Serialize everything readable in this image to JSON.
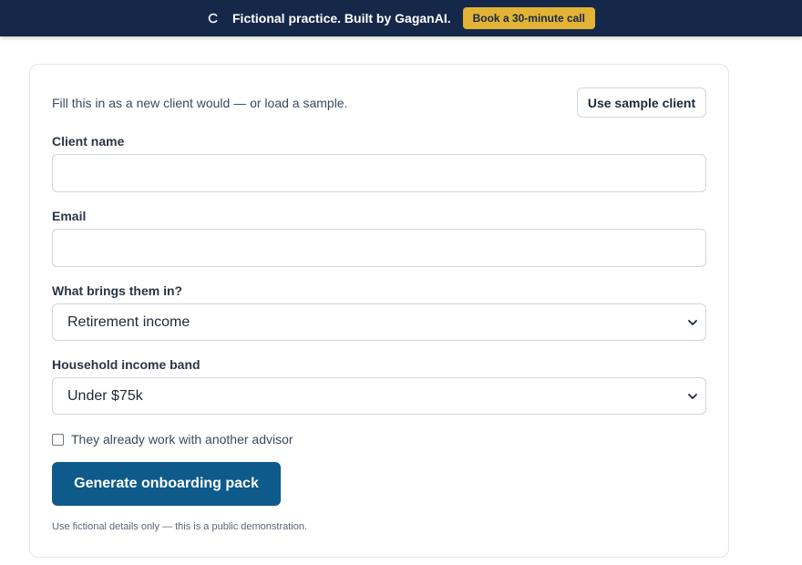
{
  "banner": {
    "logo_icon": "c-logo-icon",
    "text": "Fictional practice. Built by GaganAI.",
    "cta_label": "Book a 30-minute call",
    "background": "#16284a",
    "cta_color": "#e3b335"
  },
  "form": {
    "intro": "Fill this in as a new client would — or load a sample.",
    "sample_button": "Use sample client",
    "client_name": {
      "label": "Client name",
      "value": ""
    },
    "email": {
      "label": "Email",
      "value": ""
    },
    "reason": {
      "label": "What brings them in?",
      "selected": "Retirement income"
    },
    "income_band": {
      "label": "Household income band",
      "selected": "Under $75k"
    },
    "advisor_checkbox": {
      "label": "They already work with another advisor",
      "checked": false
    },
    "submit_label": "Generate onboarding pack",
    "submit_color": "#0e5a8a",
    "footnote": "Use fictional details only — this is a public demonstration."
  }
}
